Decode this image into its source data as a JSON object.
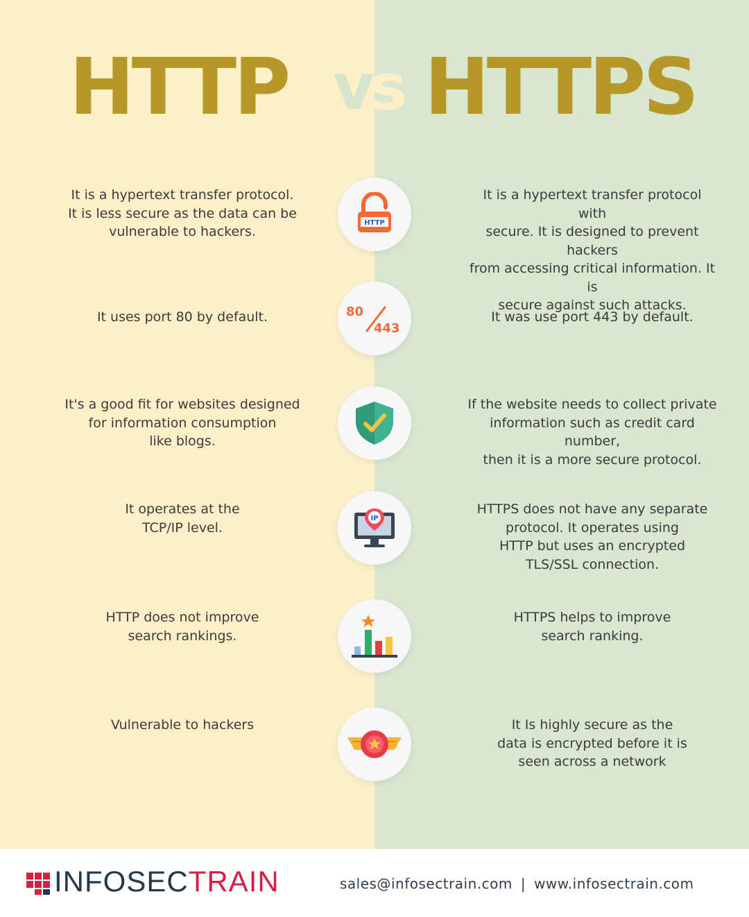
{
  "header": {
    "left_title": "HTTP",
    "vs_v": "v",
    "vs_s": "s",
    "right_title": "HTTPS"
  },
  "rows": [
    {
      "left": "It is a hypertext transfer protocol.\nIt is less secure as the data can be\nvulnerable to hackers.",
      "right": "It is a hypertext transfer protocol with\nsecure. It is designed to prevent hackers\nfrom accessing critical information. It is\nsecure against such attacks.",
      "icon": "http-padlock-icon",
      "icon_text": "HTTP"
    },
    {
      "left": "It uses port 80 by default.",
      "right": "It was use port 443 by default.",
      "icon": "port-80-443-icon",
      "icon_text_a": "80",
      "icon_text_b": "443"
    },
    {
      "left": "It's a good fit for websites designed\nfor information consumption\nlike blogs.",
      "right": "If the website needs to collect private\ninformation such as credit card number,\nthen it is a more secure protocol.",
      "icon": "shield-check-icon"
    },
    {
      "left": "It operates at the\nTCP/IP level.",
      "right": "HTTPS does not have any separate\nprotocol. It operates using\nHTTP but uses an encrypted\nTLS/SSL connection.",
      "icon": "monitor-ip-icon",
      "icon_text": "IP"
    },
    {
      "left": "HTTP does not improve\nsearch rankings.",
      "right": "HTTPS helps to improve\nsearch ranking.",
      "icon": "bar-chart-star-icon"
    },
    {
      "left": "Vulnerable to hackers",
      "right": "It Is highly secure as the\ndata is encrypted before it is\nseen across a network",
      "icon": "winged-star-badge-icon"
    }
  ],
  "footer": {
    "brand_a": "INFOSEC",
    "brand_b": "TRAIN",
    "email": "sales@infosectrain.com",
    "separator": "|",
    "website": "www.infosectrain.com"
  },
  "colors": {
    "left_bg": "#fdf0c9",
    "right_bg": "#d9e7d1",
    "title": "#b59827",
    "brand_dark": "#23384a",
    "brand_red": "#d81e45"
  }
}
